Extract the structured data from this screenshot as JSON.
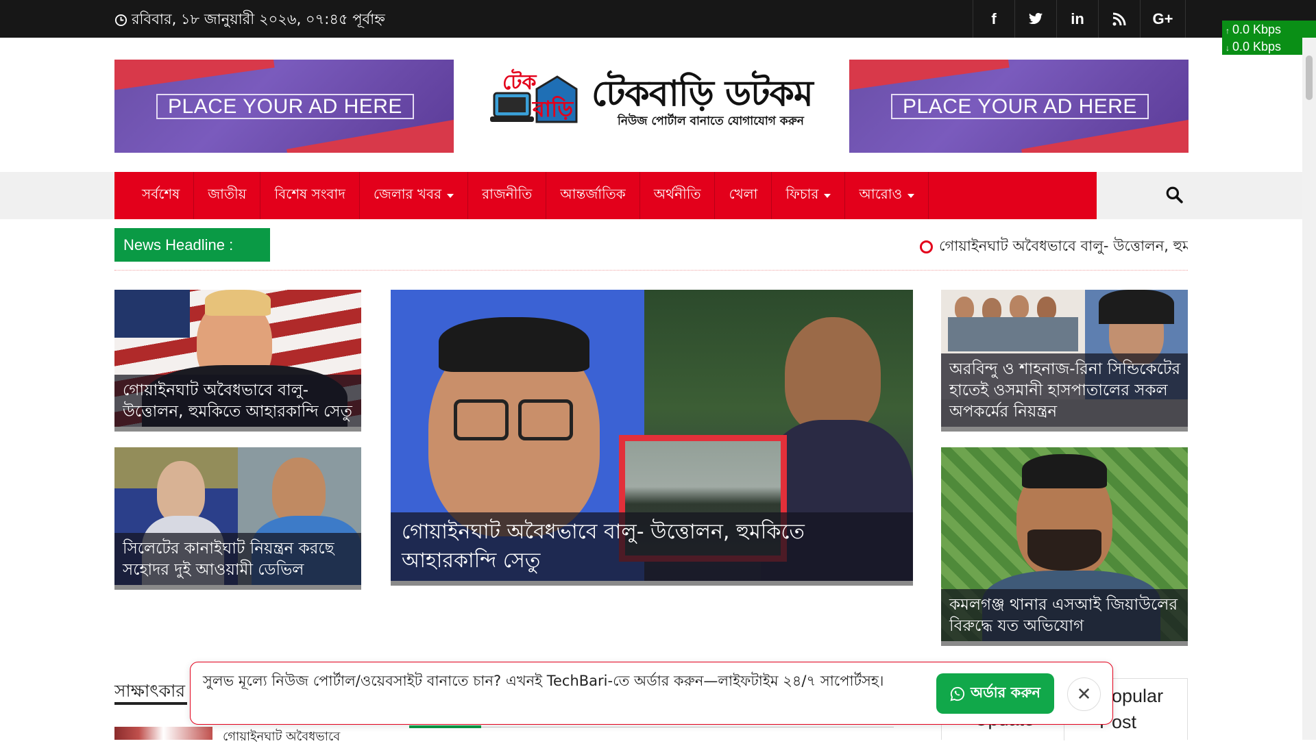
{
  "topbar": {
    "date": "রবিবার, ১৮ জানুয়ারী ২০২৬, ০৭:৪৫ পূর্বাহ্ন",
    "social": [
      {
        "icon": "facebook-icon",
        "glyph": "f"
      },
      {
        "icon": "twitter-icon",
        "glyph": "🐦"
      },
      {
        "icon": "linkedin-icon",
        "glyph": "in"
      },
      {
        "icon": "rss-icon",
        "glyph": "◉"
      },
      {
        "icon": "google-plus-icon",
        "glyph": "G+"
      }
    ]
  },
  "speed_meter": {
    "up": "0.0 Kbps",
    "down": "0.0 Kbps"
  },
  "ads": {
    "left_text": "PLACE YOUR AD HERE",
    "right_text": "PLACE YOUR AD HERE"
  },
  "logo": {
    "badge_top": "টেক",
    "badge_bottom": "বাড়ি",
    "title": "টেকবাড়ি ডটকম",
    "subtitle": "নিউজ পোর্টাল বানাতে যোগাযোগ করুন"
  },
  "nav": {
    "items": [
      {
        "label": "সর্বশেষ",
        "dropdown": false
      },
      {
        "label": "জাতীয়",
        "dropdown": false
      },
      {
        "label": "বিশেষ সংবাদ",
        "dropdown": false
      },
      {
        "label": "জেলার খবর",
        "dropdown": true
      },
      {
        "label": "রাজনীতি",
        "dropdown": false
      },
      {
        "label": "আন্তর্জাতিক",
        "dropdown": false
      },
      {
        "label": "অর্থনীতি",
        "dropdown": false
      },
      {
        "label": "খেলা",
        "dropdown": false
      },
      {
        "label": "ফিচার",
        "dropdown": true
      },
      {
        "label": "আরোও",
        "dropdown": true
      }
    ]
  },
  "headline": {
    "label": "News Headline :",
    "ticker": "গোয়াইনঘাট অবৈধভাবে বালু- উত্তোলন, হুম"
  },
  "stories": {
    "left_top": "গোয়াইনঘাট অবৈধভাবে বালু- উত্তোলন, হুমকিতে আহারকান্দি সেতু",
    "left_bottom": "সিলেটের কানাইঘাট নিয়ন্ত্রন করছে সহোদর দুই আওয়ামী ডেভিল",
    "center": "গোয়াইনঘাট অবৈধভাবে বালু- উত্তোলন, হুমকিতে আহারকান্দি সেতু",
    "right_top": "অরবিন্দু ও শাহনাজ-রিনা সিন্ডিকেটের হাতেই ওসমানী হাসপাতালের সকল অপকর্মের নিয়ন্ত্রন",
    "right_bottom": "কমলগঞ্জ থানার এসআই জিয়াউলের বিরুদ্ধে যত অভিযোগ"
  },
  "section": {
    "title": "সাক্ষাৎকার",
    "item_text": "গোয়াইনঘাট অবৈধভাবে"
  },
  "tabs": {
    "update": "Update",
    "popular": "Popular Post"
  },
  "popup": {
    "message": "সুলভ মূল্যে নিউজ পোর্টাল/ওয়েবসাইট বানাতে চান? এখনই TechBari-তে অর্ডার করুন—লাইফটাইম ২৪/৭ সাপোর্টসহ।",
    "button": "অর্ডার করুন",
    "close": "✕"
  },
  "colors": {
    "brand_red": "#e3001b",
    "headline_green": "#0a9a45",
    "topbar": "#171717"
  }
}
